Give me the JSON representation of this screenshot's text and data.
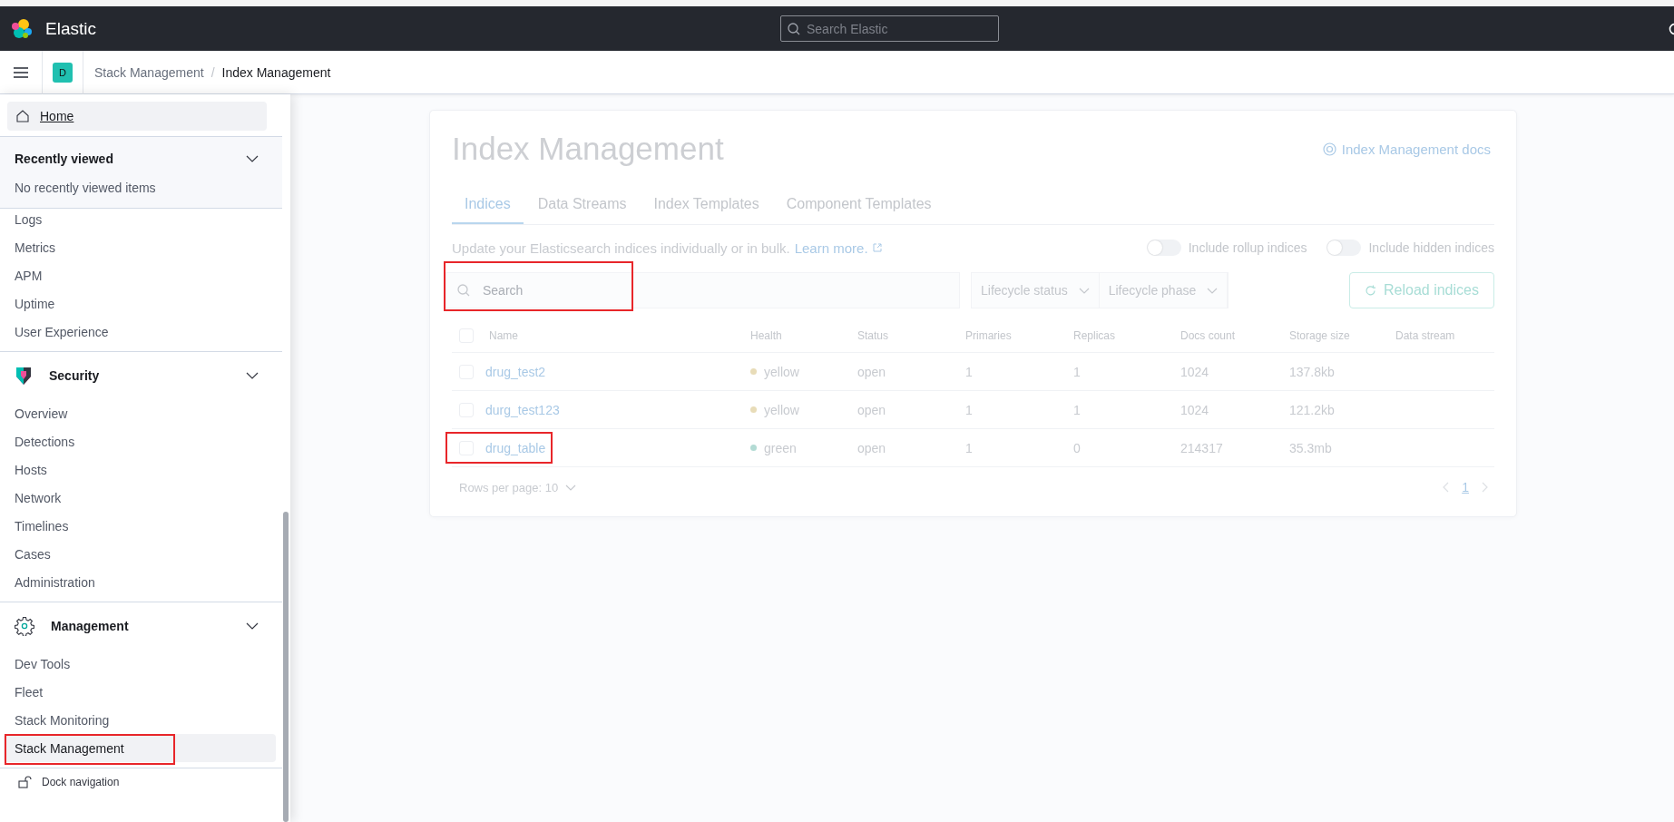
{
  "top_bar": {
    "brand": "Elastic",
    "search": {
      "placeholder": "Search Elastic"
    }
  },
  "header": {
    "space_initial": "D",
    "separator": "/",
    "breadcrumbs": [
      {
        "label": "Stack Management",
        "current": false
      },
      {
        "label": "Index Management",
        "current": true
      }
    ]
  },
  "nav": {
    "home": {
      "label": "Home",
      "selected": true
    },
    "recently_viewed": {
      "title": "Recently viewed",
      "expanded": true,
      "empty_text": "No recently viewed items"
    },
    "items": [
      {
        "label": "Logs",
        "selected": false,
        "highlighted": false
      },
      {
        "label": "Metrics",
        "selected": false,
        "highlighted": false
      },
      {
        "label": "APM",
        "selected": false,
        "highlighted": false
      },
      {
        "label": "Uptime",
        "selected": false,
        "highlighted": false
      },
      {
        "label": "User Experience",
        "selected": false,
        "highlighted": false
      }
    ],
    "groups": [
      {
        "title": "Security",
        "kind": "security",
        "expanded": true,
        "items": [
          {
            "label": "Overview",
            "selected": false,
            "highlighted": false
          },
          {
            "label": "Detections",
            "selected": false,
            "highlighted": false
          },
          {
            "label": "Hosts",
            "selected": false,
            "highlighted": false
          },
          {
            "label": "Network",
            "selected": false,
            "highlighted": false
          },
          {
            "label": "Timelines",
            "selected": false,
            "highlighted": false
          },
          {
            "label": "Cases",
            "selected": false,
            "highlighted": false
          },
          {
            "label": "Administration",
            "selected": false,
            "highlighted": false
          }
        ]
      },
      {
        "title": "Management",
        "kind": "management",
        "expanded": true,
        "items": [
          {
            "label": "Dev Tools",
            "selected": false,
            "highlighted": false
          },
          {
            "label": "Fleet",
            "selected": false,
            "highlighted": false
          },
          {
            "label": "Stack Monitoring",
            "selected": false,
            "highlighted": false
          },
          {
            "label": "Stack Management",
            "selected": true,
            "highlighted": true
          }
        ]
      }
    ],
    "dock": {
      "label": "Dock navigation"
    }
  },
  "page": {
    "title": "Index Management",
    "docs_link": "Index Management docs",
    "tabs": [
      {
        "label": "Indices",
        "selected": true
      },
      {
        "label": "Data Streams",
        "selected": false
      },
      {
        "label": "Index Templates",
        "selected": false
      },
      {
        "label": "Component Templates",
        "selected": false
      }
    ],
    "description": "Update your Elasticsearch indices individually or in bulk.",
    "learn_more": "Learn more.",
    "toggles": [
      {
        "label": "Include rollup indices",
        "on": false
      },
      {
        "label": "Include hidden indices",
        "on": false
      }
    ],
    "search": {
      "placeholder": "Search",
      "highlighted": true
    },
    "filters": [
      "Lifecycle status",
      "Lifecycle phase"
    ],
    "reload_button": "Reload indices",
    "table": {
      "all_checked": false,
      "columns": [
        "Name",
        "Health",
        "Status",
        "Primaries",
        "Replicas",
        "Docs count",
        "Storage size",
        "Data stream"
      ],
      "rows": [
        {
          "checked": false,
          "highlighted": false,
          "name": "drug_test2",
          "health": "yellow",
          "color": "#e8dcb8",
          "status": "open",
          "primaries": "1",
          "replicas": "1",
          "docs_count": "1024",
          "storage_size": "137.8kb"
        },
        {
          "checked": false,
          "highlighted": false,
          "name": "durg_test123",
          "health": "yellow",
          "color": "#e8dcb8",
          "status": "open",
          "primaries": "1",
          "replicas": "1",
          "docs_count": "1024",
          "storage_size": "121.2kb"
        },
        {
          "checked": false,
          "highlighted": true,
          "name": "drug_table",
          "health": "green",
          "color": "#b3dbd4",
          "status": "open",
          "primaries": "1",
          "replicas": "0",
          "docs_count": "214317",
          "storage_size": "35.3mb"
        }
      ]
    },
    "rows_per_page": "Rows per page: 10",
    "pagination": {
      "pages": [
        {
          "label": "1",
          "selected": true
        }
      ]
    }
  }
}
